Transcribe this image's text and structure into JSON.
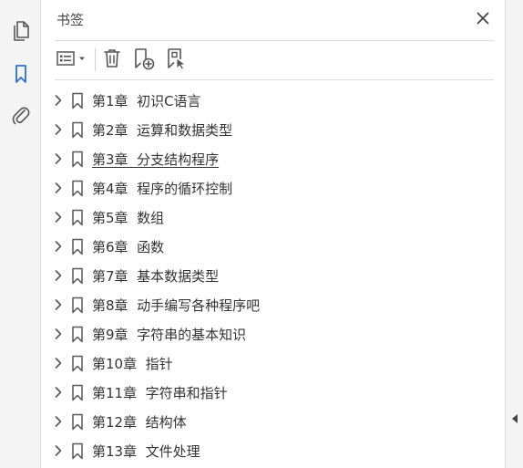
{
  "panel": {
    "title": "书签"
  },
  "rail": {
    "items": [
      {
        "name": "pages-panel",
        "icon": "pages-icon",
        "active": false
      },
      {
        "name": "bookmarks-panel",
        "icon": "bookmark-icon",
        "active": true
      },
      {
        "name": "attachments-panel",
        "icon": "paperclip-icon",
        "active": false
      }
    ]
  },
  "toolbar": {
    "icons": [
      "options-menu-icon",
      "trash-icon",
      "new-bookmark-icon",
      "bookmark-from-selection-icon"
    ]
  },
  "bookmarks": [
    {
      "label": "第1章  初识C语言",
      "underlined": false
    },
    {
      "label": "第2章  运算和数据类型",
      "underlined": false
    },
    {
      "label": "第3章  分支结构程序",
      "underlined": true
    },
    {
      "label": "第4章  程序的循环控制",
      "underlined": false
    },
    {
      "label": "第5章  数组",
      "underlined": false
    },
    {
      "label": "第6章  函数",
      "underlined": false
    },
    {
      "label": "第7章  基本数据类型",
      "underlined": false
    },
    {
      "label": "第8章  动手编写各种程序吧",
      "underlined": false
    },
    {
      "label": "第9章  字符串的基本知识",
      "underlined": false
    },
    {
      "label": "第10章  指针",
      "underlined": false
    },
    {
      "label": "第11章  字符串和指针",
      "underlined": false
    },
    {
      "label": "第12章  结构体",
      "underlined": false
    },
    {
      "label": "第13章  文件处理",
      "underlined": false
    }
  ],
  "colors": {
    "accent": "#2d6fc9",
    "icon": "#555555",
    "rail_bg": "#f4f4f4",
    "divider": "#dcdcdc"
  }
}
